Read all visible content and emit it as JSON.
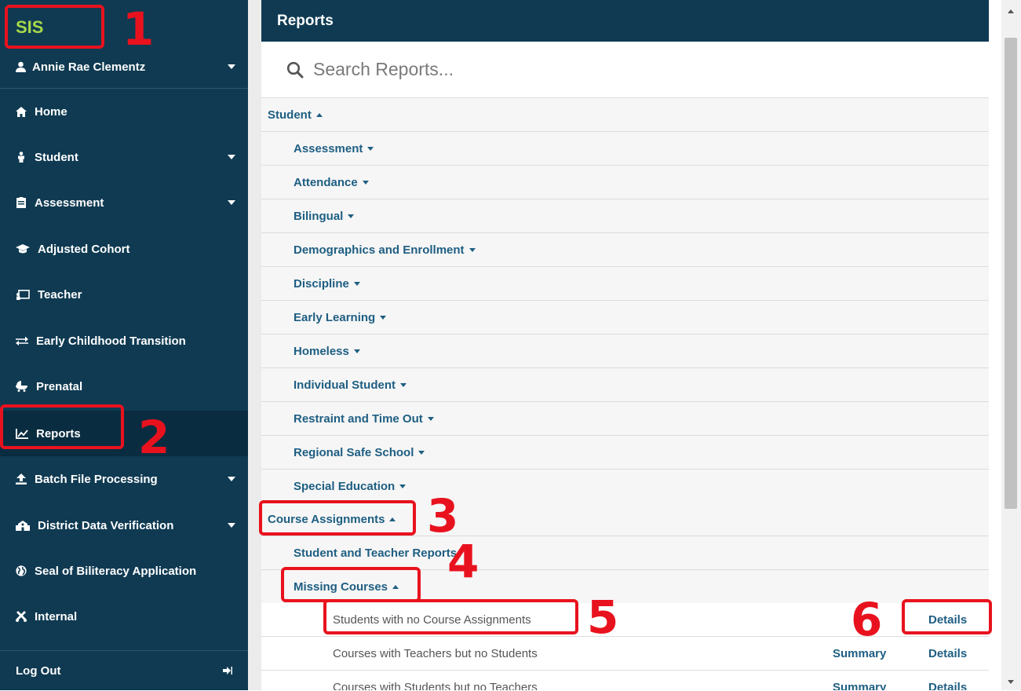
{
  "sidebar": {
    "brand": "SIS",
    "user": "Annie Rae Clementz",
    "items": [
      {
        "label": "Home",
        "icon": "home-icon"
      },
      {
        "label": "Student",
        "icon": "student-icon"
      },
      {
        "label": "Assessment",
        "icon": "clipboard-icon"
      },
      {
        "label": "Adjusted Cohort",
        "icon": "graduation-cap-icon"
      },
      {
        "label": "Teacher",
        "icon": "chalkboard-icon"
      },
      {
        "label": "Early Childhood Transition",
        "icon": "exchange-icon"
      },
      {
        "label": "Prenatal",
        "icon": "baby-carriage-icon"
      },
      {
        "label": "Reports",
        "icon": "chart-icon"
      },
      {
        "label": "Batch File Processing",
        "icon": "upload-icon"
      },
      {
        "label": "District Data Verification",
        "icon": "school-icon"
      },
      {
        "label": "Seal of Biliteracy Application",
        "icon": "globe-icon"
      },
      {
        "label": "Internal",
        "icon": "tools-icon"
      }
    ],
    "logout": "Log Out"
  },
  "main": {
    "title": "Reports",
    "search_placeholder": "Search Reports...",
    "rows": [
      {
        "label": "Student"
      },
      {
        "label": "Assessment"
      },
      {
        "label": "Attendance"
      },
      {
        "label": "Bilingual"
      },
      {
        "label": "Demographics and Enrollment"
      },
      {
        "label": "Discipline"
      },
      {
        "label": "Early Learning"
      },
      {
        "label": "Homeless"
      },
      {
        "label": "Individual Student"
      },
      {
        "label": "Restraint and Time Out"
      },
      {
        "label": "Regional Safe School"
      },
      {
        "label": "Special Education"
      },
      {
        "label": "Course Assignments"
      },
      {
        "label": "Student and Teacher Reports"
      },
      {
        "label": "Missing Courses"
      },
      {
        "label": "Students with no Course Assignments",
        "details": "Details"
      },
      {
        "label": "Courses with Teachers but no Students",
        "summary": "Summary",
        "details": "Details"
      },
      {
        "label": "Courses with Students but no Teachers",
        "summary": "Summary",
        "details": "Details"
      }
    ]
  },
  "annotations": [
    "1",
    "2",
    "3",
    "4",
    "5",
    "6"
  ],
  "colors": {
    "sidebar_bg": "#0f3a52",
    "brand": "#a7d84a",
    "link": "#1e5e82",
    "annotation": "#e8121e"
  }
}
